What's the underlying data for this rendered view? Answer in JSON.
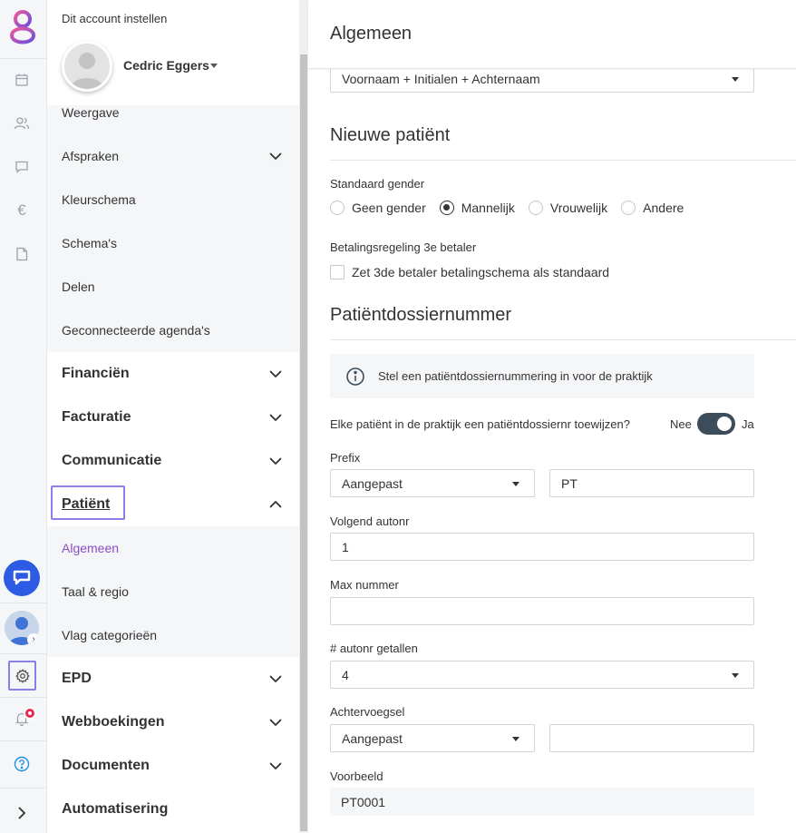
{
  "rail": {
    "items": [
      "calendar-icon",
      "users-icon",
      "chat-icon",
      "euro-icon",
      "document-icon"
    ]
  },
  "menu": {
    "account_label": "Dit account instellen",
    "user_name": "Cedric Eggers",
    "items": [
      {
        "label": "Weergave",
        "kind": "sub"
      },
      {
        "label": "Afspraken",
        "kind": "sub",
        "expand": "down"
      },
      {
        "label": "Kleurschema",
        "kind": "sub"
      },
      {
        "label": "Schema's",
        "kind": "sub"
      },
      {
        "label": "Delen",
        "kind": "sub"
      },
      {
        "label": "Geconnecteerde agenda's",
        "kind": "sub"
      },
      {
        "label": "Financiën",
        "kind": "top",
        "expand": "down"
      },
      {
        "label": "Facturatie",
        "kind": "top",
        "expand": "down"
      },
      {
        "label": "Communicatie",
        "kind": "top",
        "expand": "down"
      },
      {
        "label": "Patiënt",
        "kind": "top",
        "expand": "up",
        "selected": true
      },
      {
        "label": "Algemeen",
        "kind": "sub",
        "active": true
      },
      {
        "label": "Taal & regio",
        "kind": "sub"
      },
      {
        "label": "Vlag categorieën",
        "kind": "sub"
      },
      {
        "label": "EPD",
        "kind": "top",
        "expand": "down"
      },
      {
        "label": "Webboekingen",
        "kind": "top",
        "expand": "down"
      },
      {
        "label": "Documenten",
        "kind": "top",
        "expand": "down"
      },
      {
        "label": "Automatisering",
        "kind": "top"
      }
    ]
  },
  "main": {
    "title": "Algemeen",
    "name_format_value": "Voornaam + Initialen + Achternaam",
    "new_patient": {
      "title": "Nieuwe patiënt",
      "gender_label": "Standaard gender",
      "gender_options": [
        "Geen gender",
        "Mannelijk",
        "Vrouwelijk",
        "Andere"
      ],
      "gender_selected": "Mannelijk",
      "payment_label": "Betalingsregeling 3e betaler",
      "payment_checkbox": "Zet 3de betaler betalingschema als standaard"
    },
    "dossier": {
      "title": "Patiëntdossiernummer",
      "info": "Stel een patiëntdossiernummering in voor de praktijk",
      "assign_question": "Elke patiënt in de praktijk een patiëntdossiernr toewijzen?",
      "toggle_off": "Nee",
      "toggle_on": "Ja",
      "toggle_value": true,
      "prefix_label": "Prefix",
      "prefix_type": "Aangepast",
      "prefix_value": "PT",
      "next_label": "Volgend autonr",
      "next_value": "1",
      "max_label": "Max nummer",
      "max_value": "",
      "digits_label": "# autonr getallen",
      "digits_value": "4",
      "suffix_label": "Achtervoegsel",
      "suffix_type": "Aangepast",
      "suffix_value": "",
      "example_label": "Voorbeeld",
      "example_value": "PT0001"
    }
  }
}
